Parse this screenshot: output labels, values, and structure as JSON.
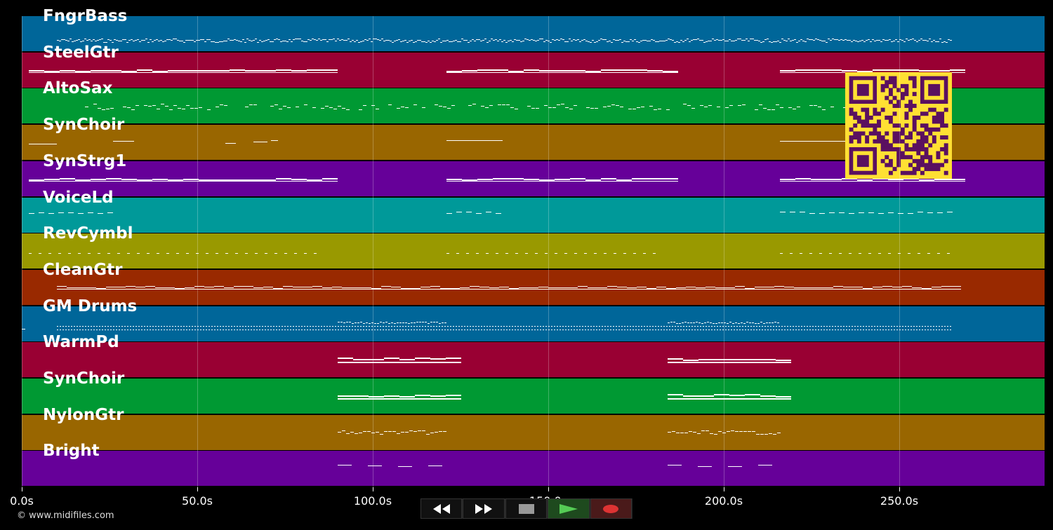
{
  "tracks": [
    {
      "name": "FngrBass",
      "color": "#006699",
      "pattern": "bass"
    },
    {
      "name": "SteelGtr",
      "color": "#990033",
      "pattern": "pad"
    },
    {
      "name": "AltoSax",
      "color": "#009933",
      "pattern": "melody"
    },
    {
      "name": "SynChoir",
      "color": "#996600",
      "pattern": "sparse"
    },
    {
      "name": "SynStrg1",
      "color": "#660099",
      "pattern": "pad"
    },
    {
      "name": "VoiceLd",
      "color": "#009999",
      "pattern": "dash"
    },
    {
      "name": "RevCymbl",
      "color": "#999900",
      "pattern": "dots"
    },
    {
      "name": "CleanGtr",
      "color": "#992900",
      "pattern": "chords"
    },
    {
      "name": "GM Drums",
      "color": "#006699",
      "pattern": "drums"
    },
    {
      "name": "WarmPd",
      "color": "#990033",
      "pattern": "blocks"
    },
    {
      "name": "SynChoir",
      "color": "#009933",
      "pattern": "blocks"
    },
    {
      "name": "NylonGtr",
      "color": "#996600",
      "pattern": "wiggle"
    },
    {
      "name": "Bright",
      "color": "#660099",
      "pattern": "short"
    }
  ],
  "timeline": {
    "total_seconds": 270,
    "ticks": [
      {
        "value": 0,
        "label": "0.0s"
      },
      {
        "value": 50,
        "label": "50.0s"
      },
      {
        "value": 100,
        "label": "100.0s"
      },
      {
        "value": 150,
        "label": "150.0s"
      },
      {
        "value": 200,
        "label": "200.0s"
      },
      {
        "value": 250,
        "label": "250.0s"
      }
    ]
  },
  "sections": {
    "a": [
      [
        2,
        90
      ],
      [
        121,
        184
      ],
      [
        216,
        265
      ]
    ],
    "b": [
      [
        90,
        121
      ],
      [
        184,
        216
      ]
    ]
  },
  "transport": {
    "buttons": [
      {
        "name": "rewind-button",
        "icon": "rewind-icon"
      },
      {
        "name": "fast-forward-button",
        "icon": "fast-forward-icon"
      },
      {
        "name": "stop-button",
        "icon": "stop-icon"
      },
      {
        "name": "play-button",
        "icon": "play-icon"
      },
      {
        "name": "record-button",
        "icon": "record-icon"
      }
    ],
    "colors": {
      "stop": "#999999",
      "play": "#55cc55",
      "record": "#dd3333",
      "play_bg": "#1e4a1e",
      "record_bg": "#4a1a1a"
    }
  },
  "qr": {
    "color": "#5a1060",
    "background": "#ffe033"
  },
  "footer": {
    "copyright": "© www.midifiles.com"
  }
}
